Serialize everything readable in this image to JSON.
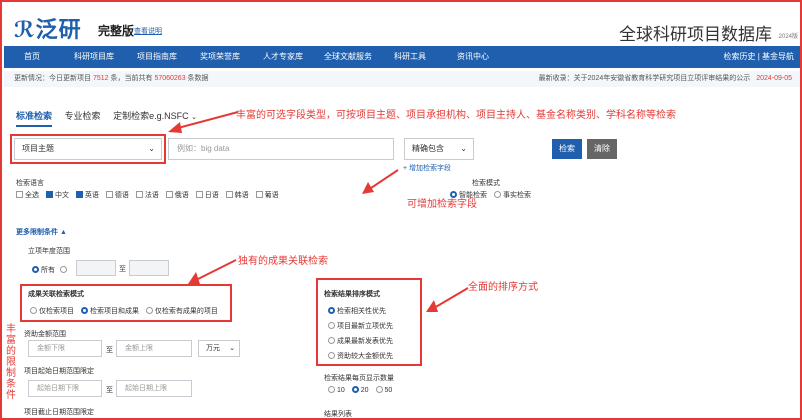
{
  "header": {
    "logo_text": "泛研",
    "edition": "完整版",
    "edition_link": "查看说明",
    "site_title": "全球科研项目数据库",
    "year": "2024版"
  },
  "nav": {
    "items": [
      "首页",
      "科研项目库",
      "项目指南库",
      "奖项荣誉库",
      "人才专家库",
      "全球文献服务",
      "科研工具",
      "资讯中心"
    ],
    "right": "检索历史 | 基金导航"
  },
  "updates": {
    "prefix": "更新情况：今日更新项目",
    "today_count": "7512",
    "mid": "条，当前共有",
    "total_count": "57060263",
    "suffix": "条数据",
    "latest_label": "最新收录：关于2024年安徽省教育科学研究项目立项评审结果的公示",
    "latest_date": "2024-09-05"
  },
  "tabs": [
    "标准检索",
    "专业检索",
    "定制检索e.g.NSFC"
  ],
  "search": {
    "field_select": "项目主题",
    "keyword_placeholder": "例如：big data",
    "match_select": "精确包含",
    "add_field": "+ 增加检索字段",
    "search_button": "检索",
    "clear_button": "清除"
  },
  "language": {
    "title": "检索语言",
    "options": [
      {
        "label": "全选",
        "checked": false
      },
      {
        "label": "中文",
        "checked": true
      },
      {
        "label": "英语",
        "checked": true
      },
      {
        "label": "德语",
        "checked": false
      },
      {
        "label": "法语",
        "checked": false
      },
      {
        "label": "俄语",
        "checked": false
      },
      {
        "label": "日语",
        "checked": false
      },
      {
        "label": "韩语",
        "checked": false
      },
      {
        "label": "葡语",
        "checked": false
      }
    ]
  },
  "mode": {
    "title": "检索模式",
    "options": [
      {
        "label": "智能检索",
        "on": true
      },
      {
        "label": "事实检索",
        "on": false
      }
    ]
  },
  "more_conditions": "更多限制条件 ▲",
  "year_range": {
    "title": "立项年度范围",
    "all": "所有",
    "to": "至"
  },
  "achievement": {
    "title": "成果关联检索模式",
    "options": [
      {
        "label": "仅检索项目",
        "on": false
      },
      {
        "label": "检索项目和成果",
        "on": true
      },
      {
        "label": "仅检索有成果的项目",
        "on": false
      }
    ]
  },
  "funding": {
    "title": "资助金额范围",
    "min_placeholder": "金额下限",
    "to": "至",
    "max_placeholder": "金额上限",
    "unit": "万元"
  },
  "start_date": {
    "title": "项目起始日期范围限定",
    "from_placeholder": "起始日期下限",
    "to": "至",
    "to_placeholder": "起始日期上限"
  },
  "end_date": {
    "title": "项目截止日期范围限定"
  },
  "sort": {
    "title": "检索结果排序模式",
    "options": [
      {
        "label": "检索相关性优先",
        "on": true
      },
      {
        "label": "项目最新立项优先",
        "on": false
      },
      {
        "label": "成果最新发表优先",
        "on": false
      },
      {
        "label": "资助较大金额优先",
        "on": false
      }
    ]
  },
  "per_page": {
    "title": "检索结果每页显示数量",
    "options": [
      {
        "label": "10",
        "on": false
      },
      {
        "label": "20",
        "on": true
      },
      {
        "label": "50",
        "on": false
      }
    ]
  },
  "result_list": "结果列表",
  "annotations": {
    "types": "丰富的可选字段类型，可按项目主题、项目承担机构、项目主持人、基金名称类别、学科名称等检索",
    "add_field": "可增加检索字段",
    "achievement": "独有的成果关联检索",
    "sort": "全面的排序方式",
    "limits": "丰富的限制条件"
  }
}
